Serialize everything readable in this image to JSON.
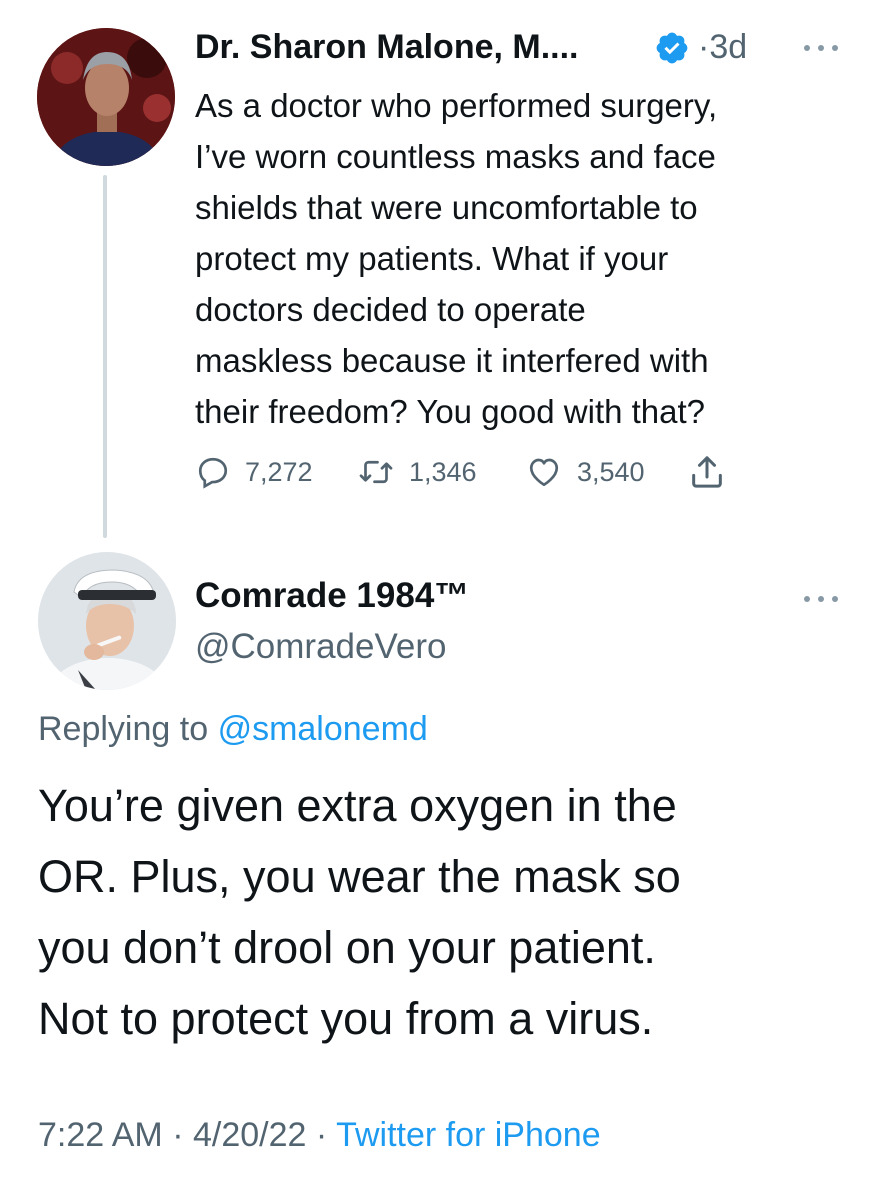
{
  "parent_tweet": {
    "author_name": "Dr. Sharon Malone, M....",
    "separator": "·",
    "time_ago": "3d",
    "text": "As a doctor who performed surgery,\nI’ve worn countless masks and face\nshields that were uncomfortable to\nprotect my patients.  What if your\ndoctors decided to operate\nmaskless because it interfered with\ntheir freedom?  You good with that?",
    "replies": "7,272",
    "retweets": "1,346",
    "likes": "3,540",
    "verified": true
  },
  "reply_tweet": {
    "author_name": "Comrade 1984™",
    "handle": "@ComradeVero",
    "replying_prefix": "Replying to",
    "replying_to": "@smalonemd",
    "text": "You’re given extra oxygen in the\nOR. Plus, you wear the mask so\nyou don’t drool on your patient.\nNot to protect you from a virus.",
    "time": "7:22 AM",
    "dot": "·",
    "date": "4/20/22",
    "source": "Twitter for iPhone"
  },
  "icons": {
    "verified": "verified-badge-icon",
    "reply": "reply-icon",
    "retweet": "retweet-icon",
    "like": "heart-icon",
    "share": "share-icon",
    "more": "more-icon"
  },
  "colors": {
    "accent": "#1d9bf0",
    "secondary_text": "#536471",
    "primary_text": "#0f1419"
  }
}
